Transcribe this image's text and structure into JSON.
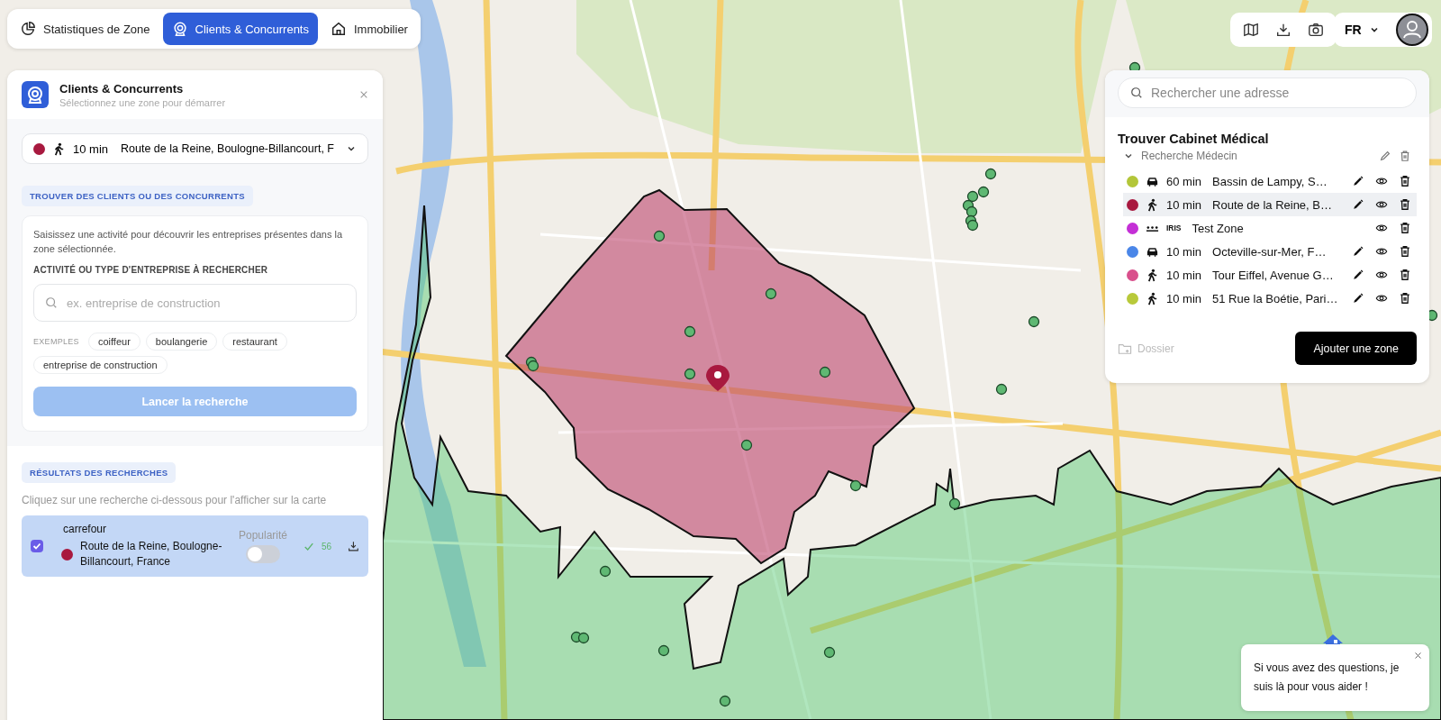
{
  "nav_tabs": [
    {
      "label": "Statistiques de Zone",
      "kind": "stats",
      "selected": false
    },
    {
      "label": "Clients & Concurrents",
      "kind": "clients",
      "selected": true
    },
    {
      "label": "Immobilier",
      "kind": "realestate",
      "selected": false
    }
  ],
  "top_toolbar": {
    "language": "FR"
  },
  "panel": {
    "title": "Clients & Concurrents",
    "subtitle": "Sélectionnez une zone pour démarrer",
    "zone_select": {
      "color": "#a8193f",
      "kind": "walk",
      "time": "10 min",
      "address": "Route de la Reine, Boulogne-Billancourt, F"
    },
    "finder": {
      "heading": "TROUVER DES CLIENTS OU DES CONCURRENTS",
      "description": "Saisissez une activité pour découvrir les entreprises présentes dans la zone sélectionnée.",
      "field_label": "ACTIVITÉ OU TYPE D'ENTREPRISE À RECHERCHER",
      "placeholder": "ex. entreprise de construction",
      "examples_label": "EXEMPLES",
      "examples": [
        "coiffeur",
        "boulangerie",
        "restaurant",
        "entreprise de construction"
      ],
      "button": "Lancer la recherche",
      "button_disabled": true
    },
    "results": {
      "heading": "RÉSULTATS DES RECHERCHES",
      "hint": "Cliquez sur une recherche ci-dessous pour l'afficher sur la carte",
      "items": [
        {
          "name": "carrefour",
          "address": "Route de la Reine, Boulogne-Billancourt, France",
          "color": "#a8193f",
          "checked": true,
          "popularity_label": "Popularité",
          "popularity_on": false,
          "count": "56"
        }
      ]
    }
  },
  "zones_panel": {
    "search_placeholder": "Rechercher une adresse",
    "project": "Trouver Cabinet Médical",
    "group": {
      "name": "Recherche Médecin",
      "expanded": true
    },
    "zones": [
      {
        "color": "#b3c639",
        "kind": "car",
        "time": "60 min",
        "label": "Bassin de Lampy, S…",
        "selected": false,
        "editable": true
      },
      {
        "color": "#a8193f",
        "kind": "walk",
        "time": "10 min",
        "label": "Route de la Reine, B…",
        "selected": true,
        "editable": true
      },
      {
        "color": "#c42fd6",
        "kind": "iris",
        "time": "IRIS",
        "label": "Test Zone",
        "selected": false,
        "editable": false
      },
      {
        "color": "#4a86e8",
        "kind": "car",
        "time": "10 min",
        "label": "Octeville-sur-Mer, F…",
        "selected": false,
        "editable": true
      },
      {
        "color": "#d9508c",
        "kind": "walk",
        "time": "10 min",
        "label": "Tour Eiffel, Avenue G…",
        "selected": false,
        "editable": true
      },
      {
        "color": "#b8c93a",
        "kind": "walk",
        "time": "10 min",
        "label": "51 Rue la Boétie, Pari…",
        "selected": false,
        "editable": true
      }
    ],
    "folder": "Dossier",
    "add_button": "Ajouter une zone"
  },
  "chat": {
    "message": "Si vous avez des questions, je suis là pour vous aider !"
  }
}
